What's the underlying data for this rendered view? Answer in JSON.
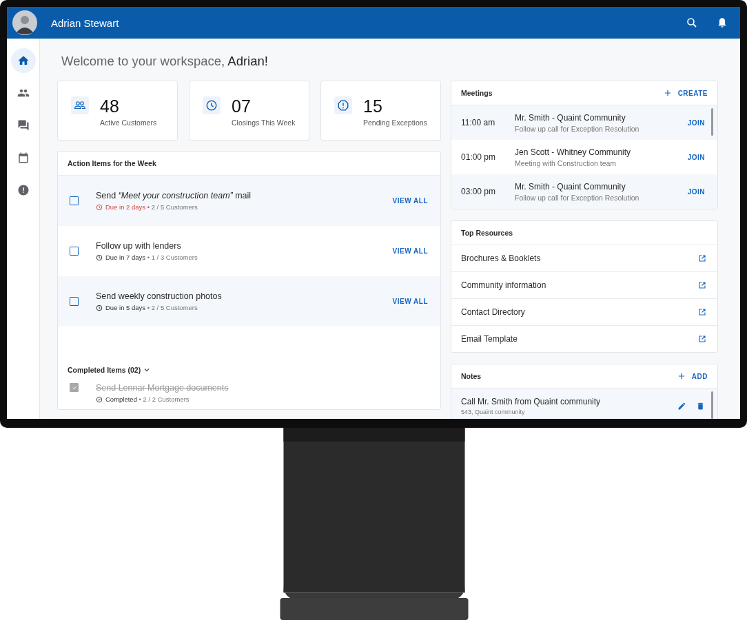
{
  "header": {
    "user_name": "Adrian Stewart"
  },
  "sidebar": {
    "items": [
      {
        "selected": true
      },
      {
        "selected": false
      },
      {
        "selected": false
      },
      {
        "selected": false
      },
      {
        "selected": false
      }
    ]
  },
  "welcome": {
    "greeting": "Welcome to your workspace,",
    "name": "Adrian!"
  },
  "stats": [
    {
      "value": "48",
      "label": "Active Customers"
    },
    {
      "value": "07",
      "label": "Closings This Week"
    },
    {
      "value": "15",
      "label": "Pending Exceptions"
    }
  ],
  "action_items": {
    "title": "Action Items for the Week",
    "items": [
      {
        "title": "Send *“Meet your construction team”* mail",
        "checked": false,
        "overdue": true,
        "due": "Due in 2 days",
        "separator": "•",
        "customers": "2 / 5 Customers",
        "action": "VIEW ALL"
      },
      {
        "title": "Follow up with lenders",
        "checked": false,
        "overdue": false,
        "due": "Due in 7 days",
        "separator": "•",
        "customers": "1 / 3 Customers",
        "action": "VIEW ALL"
      },
      {
        "title": "Send weekly construction photos",
        "checked": false,
        "overdue": false,
        "due": "Due in 5 days",
        "separator": "•",
        "customers": "2 / 5 Customers",
        "action": "VIEW ALL"
      }
    ],
    "completed": {
      "label": "Completed Items (02)",
      "expanded": true,
      "items": [
        {
          "title": "Send Lennar Mortgage documents",
          "checked": true,
          "status": "Completed",
          "separator": "•",
          "customers": "2 / 2 Customers"
        }
      ]
    }
  },
  "meetings": {
    "title": "Meetings",
    "create": "CREATE",
    "items": [
      {
        "time": "11:00 am",
        "title": "Mr. Smith - Quaint Community",
        "subtitle": "Follow up call for Exception Resolution",
        "action": "JOIN"
      },
      {
        "time": "01:00 pm",
        "title": "Jen Scott - Whitney Community",
        "subtitle": "Meeting with Construction team",
        "action": "JOIN"
      },
      {
        "time": "03:00 pm",
        "title": "Mr. Smith - Quaint Community",
        "subtitle": "Follow up call for Exception Resolution",
        "action": "JOIN"
      }
    ]
  },
  "resources": {
    "title": "Top Resources",
    "items": [
      "Brochures & Booklets",
      "Community information",
      "Contact Directory",
      "Email Template"
    ]
  },
  "notes": {
    "title": "Notes",
    "add": "ADD",
    "items": [
      {
        "title": "Call Mr. Smith from Quaint community",
        "subtitle": "543, Quaint community"
      }
    ]
  }
}
